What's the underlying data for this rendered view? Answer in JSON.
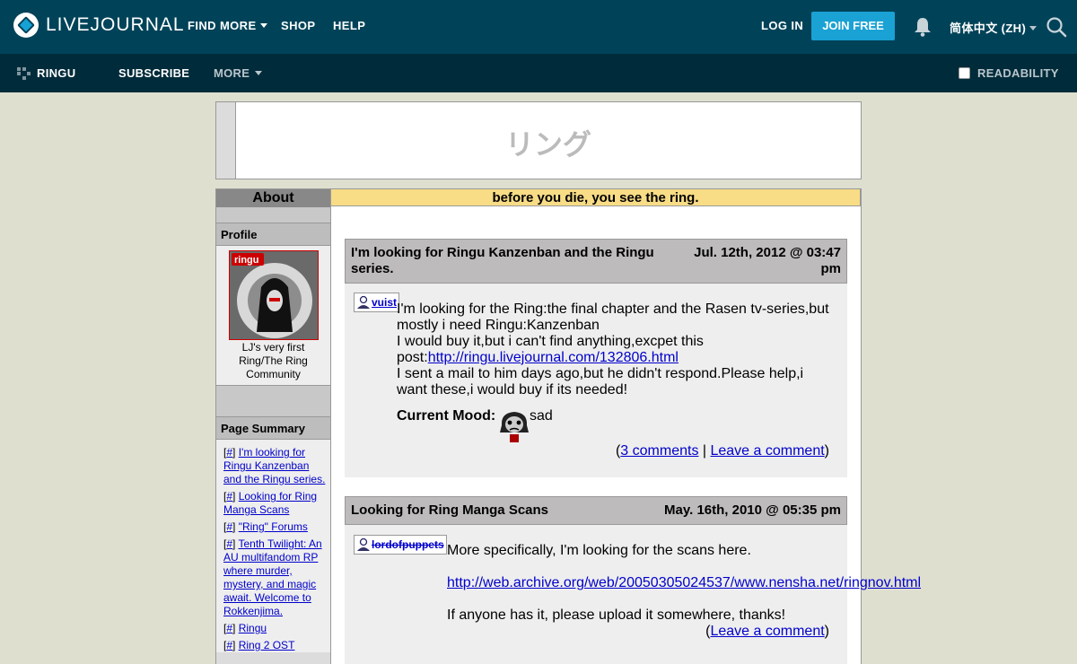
{
  "topbar": {
    "logo_text": "LIVEJOURNAL",
    "nav": [
      "FIND MORE",
      "SHOP",
      "HELP"
    ],
    "login": "LOG IN",
    "join": "JOIN FREE",
    "language": "简体中文 (ZH)"
  },
  "subbar": {
    "journal_name": "RINGU",
    "subscribe": "SUBSCRIBE",
    "more": "MORE",
    "readability": "READABILITY"
  },
  "header": {
    "title": "リング"
  },
  "sidebar": {
    "about": "About",
    "profile_heading": "Profile",
    "userpic_label": "ringu",
    "profile_desc": [
      "LJ's very first",
      "Ring/The Ring",
      "Community"
    ],
    "summary_heading": "Page Summary",
    "summary_items": [
      {
        "hash": "#",
        "text": "I'm looking for Ringu Kanzenban and the Ringu series."
      },
      {
        "hash": "#",
        "text": "Looking for Ring Manga Scans"
      },
      {
        "hash": "#",
        "text": "\"Ring\" Forums"
      },
      {
        "hash": "#",
        "text": "Tenth Twilight: An AU multifandom RP where murder, mystery, and magic await. Welcome to Rokkenjima."
      },
      {
        "hash": "#",
        "text": "Ringu"
      },
      {
        "hash": "#",
        "text": "Ring 2 OST"
      }
    ]
  },
  "main": {
    "tagline": "before you die, you see the ring.",
    "entries": [
      {
        "title": "I'm looking for Ringu Kanzenban and the Ringu series.",
        "date": "Jul. 12th, 2012 @ 03:47 pm",
        "poster": "vuist",
        "body_lines": [
          "I'm looking for the Ring:the final chapter and the Rasen tv-series,but",
          "mostly i need Ringu:Kanzenban",
          "I would buy it,but i can't find anything,excpet this"
        ],
        "post_prefix": "post:",
        "link": "http://ringu.livejournal.com/132806.html",
        "body_lines2": [
          "I sent a mail to him days ago,but he didn't respond.Please help,i",
          "want these,i would buy if its needed!"
        ],
        "mood_label": "Current Mood:",
        "mood": "sad",
        "comments": "3 comments",
        "leave": "Leave a comment"
      },
      {
        "title": "Looking for Ring Manga Scans",
        "date": "May. 16th, 2010 @ 05:35 pm",
        "poster": "lordofpuppets",
        "line1": "More specifically, I'm looking for the scans here.",
        "link": "http://web.archive.org/web/20050305024537/www.nensha.net/ringnov.html",
        "line2": "If anyone has it, please upload it somewhere, thanks!",
        "leave": "Leave a comment"
      }
    ]
  },
  "colors": {
    "topbar": "#004359",
    "subbar": "#002b3a",
    "join_button": "#1aa2d4",
    "tagline_bg": "#f8dc86",
    "page_bg": "#dfdfd0"
  }
}
